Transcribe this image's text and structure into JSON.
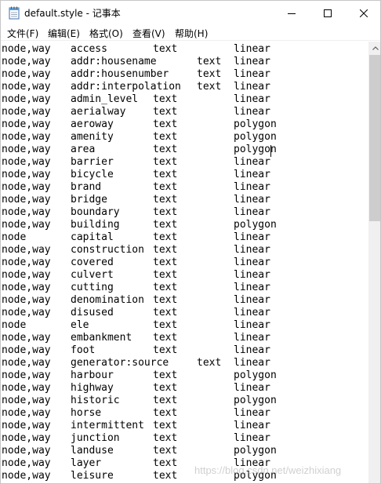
{
  "window": {
    "title": "default.style - 记事本",
    "app_icon": "notepad-icon"
  },
  "menu": [
    {
      "label": "文件(F)"
    },
    {
      "label": "编辑(E)"
    },
    {
      "label": "格式(O)"
    },
    {
      "label": "查看(V)"
    },
    {
      "label": "帮助(H)"
    }
  ],
  "editor": {
    "lines": [
      [
        "node,way",
        "access",
        "text",
        "linear"
      ],
      [
        "node,way",
        "addr:housename",
        "text",
        "linear"
      ],
      [
        "node,way",
        "addr:housenumber",
        "text",
        "linear"
      ],
      [
        "node,way",
        "addr:interpolation",
        "text",
        "linear"
      ],
      [
        "node,way",
        "admin_level",
        "text",
        "linear"
      ],
      [
        "node,way",
        "aerialway",
        "text",
        "linear"
      ],
      [
        "node,way",
        "aeroway",
        "text",
        "polygon"
      ],
      [
        "node,way",
        "amenity",
        "text",
        "polygon"
      ],
      [
        "node,way",
        "area",
        "text",
        "polygon"
      ],
      [
        "node,way",
        "barrier",
        "text",
        "linear"
      ],
      [
        "node,way",
        "bicycle",
        "text",
        "linear"
      ],
      [
        "node,way",
        "brand",
        "text",
        "linear"
      ],
      [
        "node,way",
        "bridge",
        "text",
        "linear"
      ],
      [
        "node,way",
        "boundary",
        "text",
        "linear"
      ],
      [
        "node,way",
        "building",
        "text",
        "polygon"
      ],
      [
        "node",
        "capital",
        "text",
        "linear"
      ],
      [
        "node,way",
        "construction",
        "text",
        "linear"
      ],
      [
        "node,way",
        "covered",
        "text",
        "linear"
      ],
      [
        "node,way",
        "culvert",
        "text",
        "linear"
      ],
      [
        "node,way",
        "cutting",
        "text",
        "linear"
      ],
      [
        "node,way",
        "denomination",
        "text",
        "linear"
      ],
      [
        "node,way",
        "disused",
        "text",
        "linear"
      ],
      [
        "node",
        "ele",
        "text",
        "linear"
      ],
      [
        "node,way",
        "embankment",
        "text",
        "linear"
      ],
      [
        "node,way",
        "foot",
        "text",
        "linear"
      ],
      [
        "node,way",
        "generator:source",
        "text",
        "linear"
      ],
      [
        "node,way",
        "harbour",
        "text",
        "polygon"
      ],
      [
        "node,way",
        "highway",
        "text",
        "linear"
      ],
      [
        "node,way",
        "historic",
        "text",
        "polygon"
      ],
      [
        "node,way",
        "horse",
        "text",
        "linear"
      ],
      [
        "node,way",
        "intermittent",
        "text",
        "linear"
      ],
      [
        "node,way",
        "junction",
        "text",
        "linear"
      ],
      [
        "node,way",
        "landuse",
        "text",
        "polygon"
      ],
      [
        "node,way",
        "layer",
        "text",
        "linear"
      ],
      [
        "node,way",
        "leisure",
        "text",
        "polygon"
      ]
    ]
  },
  "watermark": "https://blog.csdn.net/weizhixiang",
  "colors": {
    "text": "#000000",
    "scrollbar_track": "#f0f0f0",
    "scrollbar_thumb": "#cdcdcd"
  }
}
